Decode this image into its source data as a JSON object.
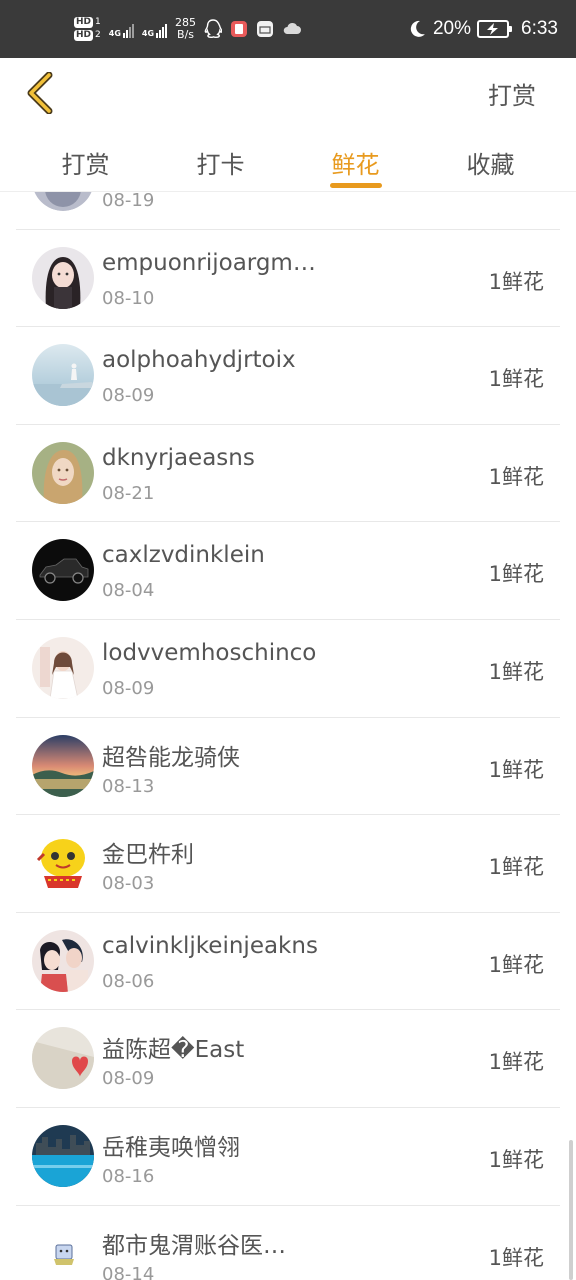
{
  "status_bar": {
    "hd1": "HD",
    "hd1_num": "1",
    "hd2": "HD",
    "hd2_num": "2",
    "net1": "4G",
    "net2": "4G",
    "speed_value": "285",
    "speed_unit": "B/s",
    "battery_percent": "20%",
    "time": "6:33"
  },
  "header": {
    "action_label": "打赏"
  },
  "tabs": [
    {
      "label": "打赏",
      "active": false
    },
    {
      "label": "打卡",
      "active": false
    },
    {
      "label": "鲜花",
      "active": true
    },
    {
      "label": "收藏",
      "active": false
    }
  ],
  "colors": {
    "accent": "#e89a1e",
    "status_bar_bg": "#3a3a3a",
    "text_primary": "#555555",
    "text_secondary": "#999999"
  },
  "list": [
    {
      "name": "",
      "date": "08-19",
      "amount": "",
      "avatar": "partial-avatar"
    },
    {
      "name": "empuonrijoargm…",
      "date": "08-10",
      "amount": "1鲜花",
      "avatar": "girl-dark-hair"
    },
    {
      "name": "aolphoahydjrtoix",
      "date": "08-09",
      "amount": "1鲜花",
      "avatar": "figure-on-sea"
    },
    {
      "name": "dknyrjaeasns",
      "date": "08-21",
      "amount": "1鲜花",
      "avatar": "girl-blonde"
    },
    {
      "name": "caxlzvdinklein",
      "date": "08-04",
      "amount": "1鲜花",
      "avatar": "black-car"
    },
    {
      "name": "lodvvemhoschinco",
      "date": "08-09",
      "amount": "1鲜花",
      "avatar": "girl-white-dress"
    },
    {
      "name": "超咎能龙骑侠",
      "date": "08-13",
      "amount": "1鲜花",
      "avatar": "sunset-landscape"
    },
    {
      "name": "金巴杵利",
      "date": "08-03",
      "amount": "1鲜花",
      "avatar": "yellow-cartoon"
    },
    {
      "name": "calvinkljkeinjeakns",
      "date": "08-06",
      "amount": "1鲜花",
      "avatar": "couple-illustration"
    },
    {
      "name": "益陈超�East",
      "date": "08-09",
      "amount": "1鲜花",
      "avatar": "heart-card"
    },
    {
      "name": "岳稚夷唤憎翎",
      "date": "08-16",
      "amount": "1鲜花",
      "avatar": "city-blue"
    },
    {
      "name": "都市鬼渭账谷医…",
      "date": "08-14",
      "amount": "1鲜花",
      "avatar": "small-sticker"
    }
  ]
}
